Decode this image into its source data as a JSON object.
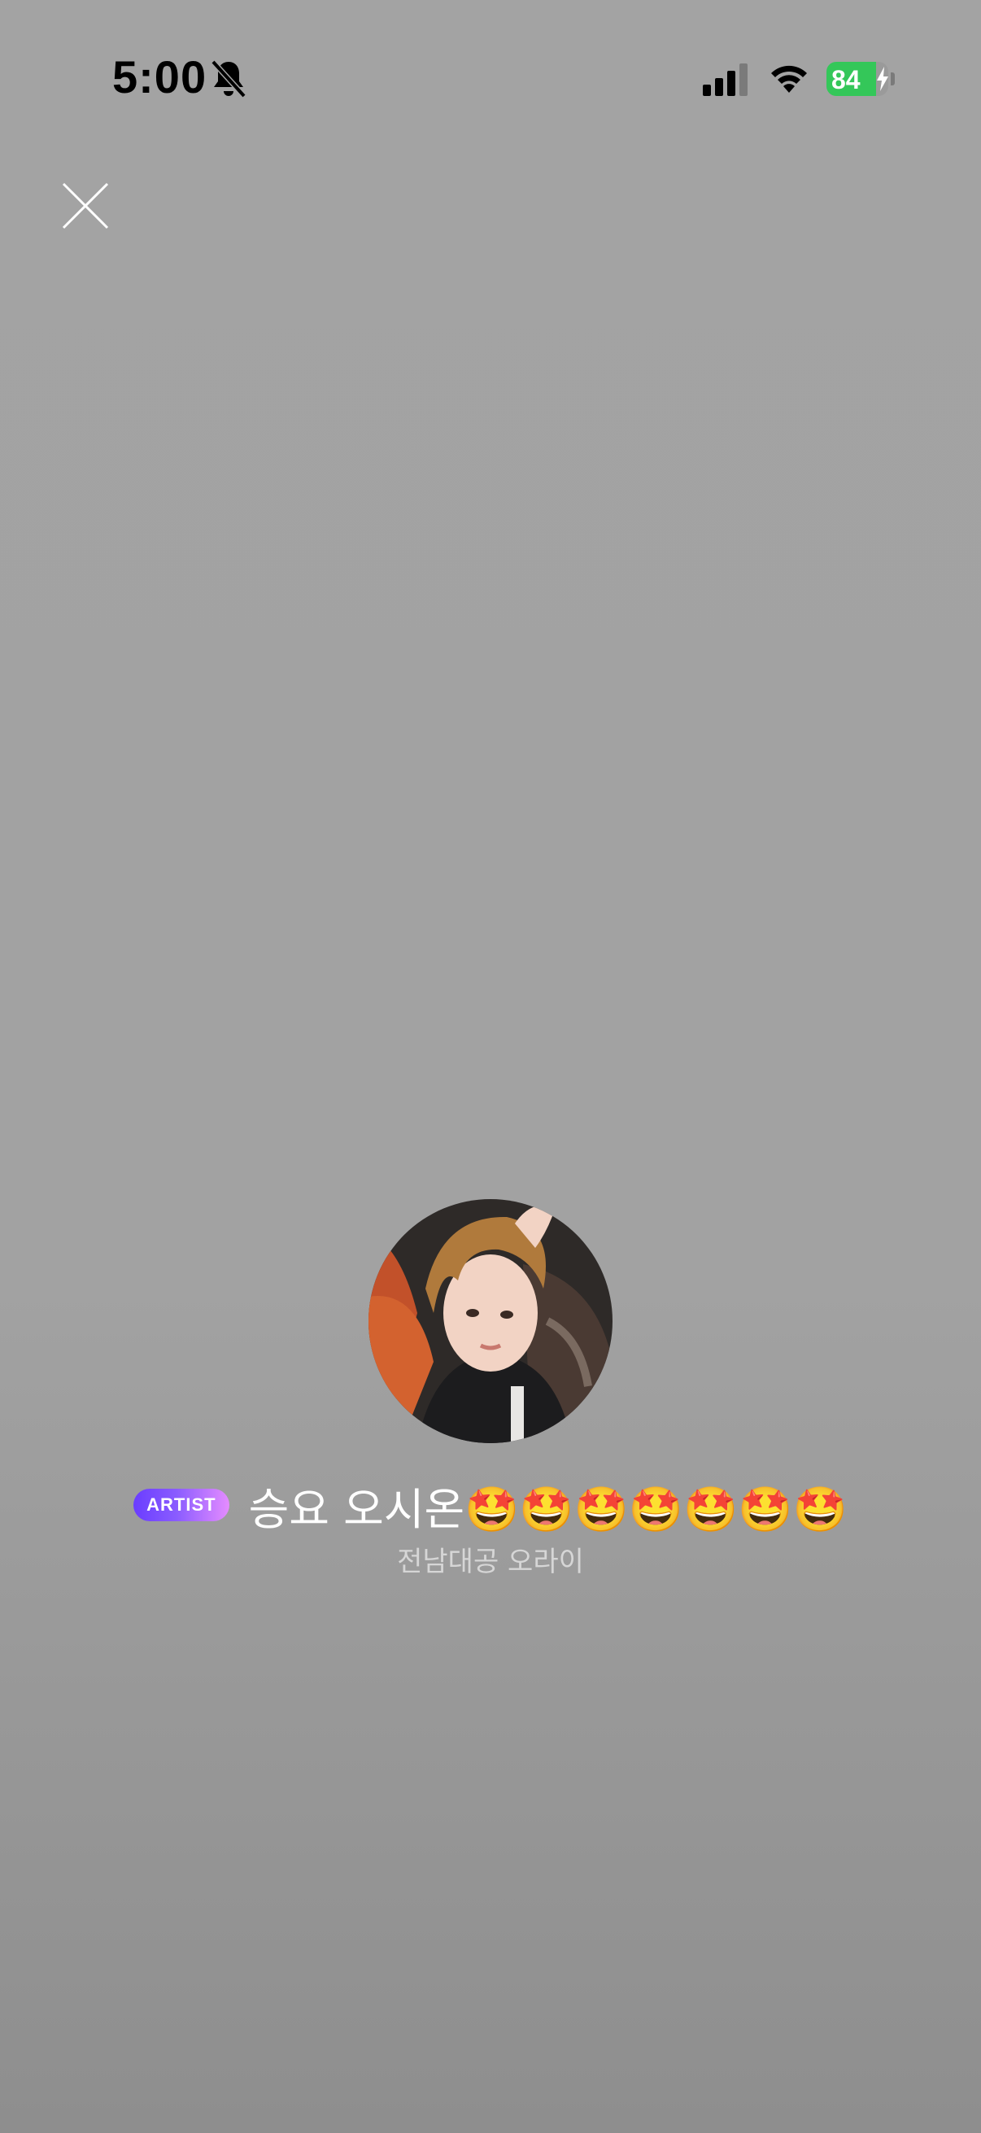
{
  "status_bar": {
    "time": "5:00",
    "battery_percent": "84",
    "battery_color": "#34c759"
  },
  "close": {
    "icon": "close-icon"
  },
  "profile": {
    "badge": "ARTIST",
    "name": "승요 오시온🤩🤩🤩🤩🤩🤩🤩",
    "subtitle": "전남대공 오라이",
    "badge_gradient": [
      "#6a3dff",
      "#e58cff"
    ]
  }
}
